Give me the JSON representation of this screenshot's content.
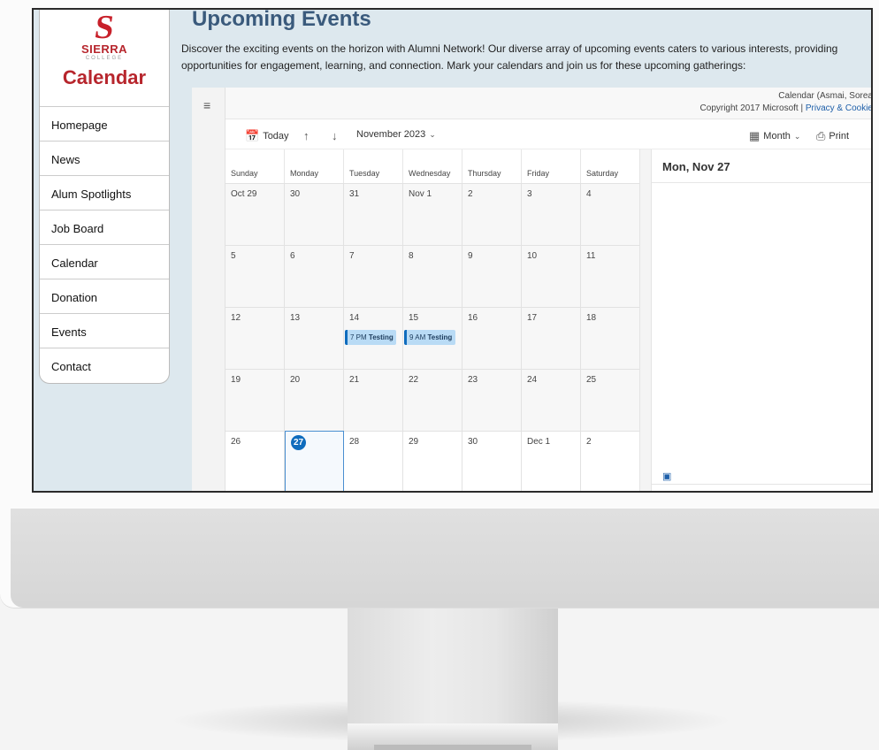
{
  "sidebar": {
    "logo": {
      "letter": "S",
      "name": "SIERRA",
      "sub": "COLLEGE"
    },
    "heading": "Calendar",
    "items": [
      {
        "label": "Homepage"
      },
      {
        "label": "News"
      },
      {
        "label": "Alum Spotlights"
      },
      {
        "label": "Job Board"
      },
      {
        "label": "Calendar"
      },
      {
        "label": "Donation"
      },
      {
        "label": "Events"
      },
      {
        "label": "Contact"
      }
    ]
  },
  "main": {
    "title": "Upcoming Events",
    "intro": "Discover the exciting events on the horizon with Alumni Network! Our diverse array of upcoming events caters to various interests, providing opportunities for engagement, learning, and connection. Mark your calendars and join us for these upcoming gatherings:"
  },
  "calendar": {
    "banner_title": "Calendar (Asmai, Sorea",
    "copyright": "Copyright 2017 Microsoft |",
    "privacy_link": "Privacy & Cookie",
    "today_label": "Today",
    "month_label": "November 2023",
    "view_label": "Month",
    "print_label": "Print",
    "weekdays": [
      "Sunday",
      "Monday",
      "Tuesday",
      "Wednesday",
      "Thursday",
      "Friday",
      "Saturday"
    ],
    "weeks": [
      [
        "Oct 29",
        "30",
        "31",
        "Nov 1",
        "2",
        "3",
        "4"
      ],
      [
        "5",
        "6",
        "7",
        "8",
        "9",
        "10",
        "11"
      ],
      [
        "12",
        "13",
        "14",
        "15",
        "16",
        "17",
        "18"
      ],
      [
        "19",
        "20",
        "21",
        "22",
        "23",
        "24",
        "25"
      ],
      [
        "26",
        "27",
        "28",
        "29",
        "30",
        "Dec 1",
        "2"
      ]
    ],
    "events": [
      {
        "time": "7 PM",
        "title": "Testing"
      },
      {
        "time": "9 AM",
        "title": "Testing"
      }
    ],
    "selected_day_heading": "Mon, Nov 27",
    "accent": "#0f6cbd"
  }
}
